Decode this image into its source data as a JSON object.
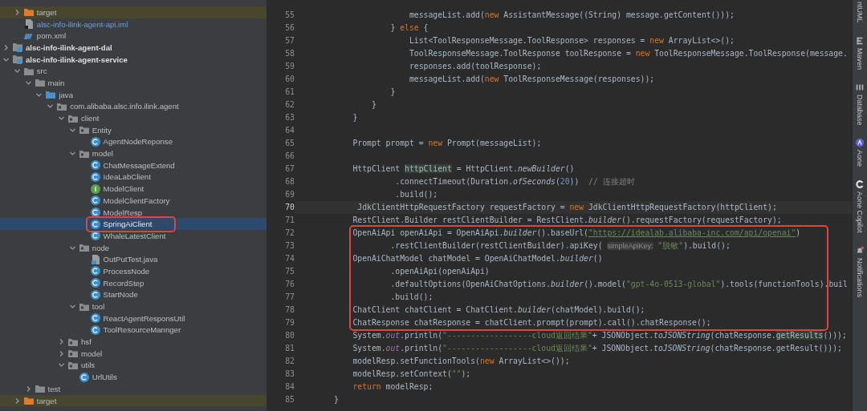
{
  "tree": {
    "continued_children": [
      {
        "label": "target",
        "kind": "excluded-folder",
        "expanded": false,
        "selected": false,
        "annotated": false
      },
      {
        "label": "alsc-info-ilink-agent-api.iml",
        "kind": "iml-file",
        "selected": false,
        "annotated": false
      },
      {
        "label": "pom.xml",
        "kind": "xml-file",
        "selected": false,
        "annotated": false
      }
    ],
    "items": [
      {
        "label": "alsc-info-ilink-agent-dal",
        "kind": "module",
        "expanded": false,
        "selected": false,
        "annotated": false
      },
      {
        "label": "alsc-info-ilink-agent-service",
        "kind": "module",
        "expanded": true,
        "selected": false,
        "annotated": false,
        "children": [
          {
            "label": "src",
            "kind": "folder",
            "expanded": true,
            "selected": false,
            "annotated": false,
            "children": [
              {
                "label": "main",
                "kind": "folder",
                "expanded": true,
                "selected": false,
                "annotated": false,
                "children": [
                  {
                    "label": "java",
                    "kind": "source-folder",
                    "expanded": true,
                    "selected": false,
                    "annotated": false,
                    "children": [
                      {
                        "label": "com.alibaba.alsc.info.ilink.agent",
                        "kind": "package",
                        "expanded": true,
                        "selected": false,
                        "annotated": false,
                        "children": [
                          {
                            "label": "client",
                            "kind": "package",
                            "expanded": true,
                            "selected": false,
                            "annotated": false,
                            "children": [
                              {
                                "label": "Entity",
                                "kind": "package",
                                "expanded": true,
                                "selected": false,
                                "annotated": false,
                                "children": [
                                  {
                                    "label": "AgentNodeReponse",
                                    "kind": "class",
                                    "selected": false,
                                    "annotated": false
                                  }
                                ]
                              },
                              {
                                "label": "model",
                                "kind": "package",
                                "expanded": true,
                                "selected": false,
                                "annotated": false,
                                "children": [
                                  {
                                    "label": "ChatMessageExtend",
                                    "kind": "class",
                                    "selected": false,
                                    "annotated": false
                                  },
                                  {
                                    "label": "IdeaLabClient",
                                    "kind": "class",
                                    "selected": false,
                                    "annotated": false
                                  },
                                  {
                                    "label": "ModelClient",
                                    "kind": "interface",
                                    "selected": false,
                                    "annotated": false
                                  },
                                  {
                                    "label": "ModelClientFactory",
                                    "kind": "class",
                                    "selected": false,
                                    "annotated": false
                                  },
                                  {
                                    "label": "ModelResp",
                                    "kind": "class",
                                    "selected": false,
                                    "annotated": false
                                  },
                                  {
                                    "label": "SpringAiClient",
                                    "kind": "class",
                                    "selected": true,
                                    "annotated": true
                                  },
                                  {
                                    "label": "WhaleLatestClient",
                                    "kind": "class",
                                    "selected": false,
                                    "annotated": false
                                  }
                                ]
                              },
                              {
                                "label": "node",
                                "kind": "package",
                                "expanded": true,
                                "selected": false,
                                "annotated": false,
                                "children": [
                                  {
                                    "label": "OutPutTest.java",
                                    "kind": "java-file",
                                    "selected": false,
                                    "annotated": false
                                  },
                                  {
                                    "label": "ProcessNode",
                                    "kind": "class",
                                    "selected": false,
                                    "annotated": false
                                  },
                                  {
                                    "label": "RecordStep",
                                    "kind": "class",
                                    "selected": false,
                                    "annotated": false
                                  },
                                  {
                                    "label": "StartNode",
                                    "kind": "class",
                                    "selected": false,
                                    "annotated": false
                                  }
                                ]
                              },
                              {
                                "label": "tool",
                                "kind": "package",
                                "expanded": true,
                                "selected": false,
                                "annotated": false,
                                "children": [
                                  {
                                    "label": "ReactAgentResponsUtil",
                                    "kind": "class",
                                    "selected": false,
                                    "annotated": false
                                  },
                                  {
                                    "label": "ToolResourceMannger",
                                    "kind": "class",
                                    "selected": false,
                                    "annotated": false
                                  }
                                ]
                              }
                            ]
                          },
                          {
                            "label": "hsf",
                            "kind": "package",
                            "expanded": false,
                            "selected": false,
                            "annotated": false
                          },
                          {
                            "label": "model",
                            "kind": "package",
                            "expanded": false,
                            "selected": false,
                            "annotated": false
                          },
                          {
                            "label": "utils",
                            "kind": "package",
                            "expanded": true,
                            "selected": false,
                            "annotated": false,
                            "children": [
                              {
                                "label": "UrlUtils",
                                "kind": "class",
                                "selected": false,
                                "annotated": false
                              }
                            ]
                          }
                        ]
                      }
                    ]
                  }
                ]
              },
              {
                "label": "test",
                "kind": "folder",
                "expanded": false,
                "selected": false,
                "annotated": false
              }
            ]
          },
          {
            "label": "target",
            "kind": "excluded-folder",
            "expanded": false,
            "selected": false,
            "annotated": false
          }
        ]
      }
    ]
  },
  "editor": {
    "lines": [
      {
        "number": "55",
        "current": false,
        "boxed": false,
        "segments": [
          {
            "text": "                messageList.add(",
            "kind": "plain"
          },
          {
            "text": "new",
            "kind": "keyword"
          },
          {
            "text": " AssistantMessage((String) message.getContent()));",
            "kind": "plain"
          }
        ]
      },
      {
        "number": "56",
        "current": false,
        "boxed": false,
        "segments": [
          {
            "text": "            } ",
            "kind": "plain"
          },
          {
            "text": "else",
            "kind": "keyword"
          },
          {
            "text": " {",
            "kind": "plain"
          }
        ]
      },
      {
        "number": "57",
        "current": false,
        "boxed": false,
        "segments": [
          {
            "text": "                List<ToolResponseMessage.ToolResponse> responses = ",
            "kind": "plain"
          },
          {
            "text": "new",
            "kind": "keyword"
          },
          {
            "text": " ArrayList<>();",
            "kind": "plain"
          }
        ]
      },
      {
        "number": "58",
        "current": false,
        "boxed": false,
        "segments": [
          {
            "text": "                ToolResponseMessage.ToolResponse toolResponse = ",
            "kind": "plain"
          },
          {
            "text": "new",
            "kind": "keyword"
          },
          {
            "text": " ToolResponseMessage.ToolResponse(message.",
            "kind": "plain"
          }
        ]
      },
      {
        "number": "59",
        "current": false,
        "boxed": false,
        "segments": [
          {
            "text": "                responses.add(toolResponse);",
            "kind": "plain"
          }
        ]
      },
      {
        "number": "60",
        "current": false,
        "boxed": false,
        "segments": [
          {
            "text": "                messageList.add(",
            "kind": "plain"
          },
          {
            "text": "new",
            "kind": "keyword"
          },
          {
            "text": " ToolResponseMessage(responses));",
            "kind": "plain"
          }
        ]
      },
      {
        "number": "61",
        "current": false,
        "boxed": false,
        "segments": [
          {
            "text": "            }",
            "kind": "plain"
          }
        ]
      },
      {
        "number": "62",
        "current": false,
        "boxed": false,
        "segments": [
          {
            "text": "        }",
            "kind": "plain"
          }
        ]
      },
      {
        "number": "63",
        "current": false,
        "boxed": false,
        "segments": [
          {
            "text": "    }",
            "kind": "plain"
          }
        ]
      },
      {
        "number": "64",
        "current": false
      },
      {
        "number": "65",
        "current": false,
        "boxed": false,
        "segments": [
          {
            "text": "    Prompt prompt = ",
            "kind": "plain"
          },
          {
            "text": "new",
            "kind": "keyword"
          },
          {
            "text": " Prompt(messageList);",
            "kind": "plain"
          }
        ]
      },
      {
        "number": "66",
        "current": false
      },
      {
        "number": "67",
        "current": false,
        "boxed": false,
        "segments": [
          {
            "text": "    HttpClient ",
            "kind": "plain"
          },
          {
            "text": "httpClient",
            "kind": "usage"
          },
          {
            "text": " = HttpClient.",
            "kind": "plain"
          },
          {
            "text": "newBuilder",
            "kind": "italic"
          },
          {
            "text": "()",
            "kind": "plain"
          }
        ]
      },
      {
        "number": "68",
        "current": false,
        "boxed": false,
        "segments": [
          {
            "text": "             .connectTimeout(Duration.",
            "kind": "plain"
          },
          {
            "text": "ofSeconds",
            "kind": "italic"
          },
          {
            "text": "(",
            "kind": "plain"
          },
          {
            "text": "20",
            "kind": "number"
          },
          {
            "text": "))  ",
            "kind": "plain"
          },
          {
            "text": "// 连接超时",
            "kind": "comment"
          }
        ]
      },
      {
        "number": "69",
        "current": false,
        "boxed": false,
        "segments": [
          {
            "text": "             .build();",
            "kind": "plain"
          }
        ]
      },
      {
        "number": "70",
        "current": true,
        "boxed": false,
        "segments": [
          {
            "text": "     JdkClientHttpRequestFactory requestFactory = ",
            "kind": "plain"
          },
          {
            "text": "new",
            "kind": "keyword"
          },
          {
            "text": " JdkClientHttpRequestFactory(httpClient);",
            "kind": "plain"
          }
        ]
      },
      {
        "number": "71",
        "current": false,
        "boxed": false,
        "segments": [
          {
            "text": "    RestClient.Builder restClientBuilder = RestClient.",
            "kind": "plain"
          },
          {
            "text": "builder",
            "kind": "italic"
          },
          {
            "text": "().requestFactory(requestFactory);",
            "kind": "plain"
          }
        ]
      },
      {
        "number": "72",
        "current": false,
        "boxed": true,
        "segments": [
          {
            "text": "    OpenAiApi openAiApi = OpenAiApi.",
            "kind": "plain"
          },
          {
            "text": "builder",
            "kind": "italic"
          },
          {
            "text": "().baseUrl(",
            "kind": "plain"
          },
          {
            "text": "\"https://idealab.alibaba-inc.com/api/openai\"",
            "kind": "url"
          },
          {
            "text": ")",
            "kind": "plain"
          }
        ]
      },
      {
        "number": "73",
        "current": false,
        "boxed": true,
        "segments": [
          {
            "text": "            .restClientBuilder(restClientBuilder).apiKey( ",
            "kind": "plain"
          },
          {
            "text": "simpleApiKey:",
            "kind": "hint"
          },
          {
            "text": " \"脱敏\"",
            "kind": "string"
          },
          {
            "text": ").build();",
            "kind": "plain"
          }
        ]
      },
      {
        "number": "74",
        "current": false,
        "boxed": true,
        "segments": [
          {
            "text": "    OpenAiChatModel chatModel = OpenAiChatModel.",
            "kind": "plain"
          },
          {
            "text": "builder",
            "kind": "italic"
          },
          {
            "text": "()",
            "kind": "plain"
          }
        ]
      },
      {
        "number": "75",
        "current": false,
        "boxed": true,
        "segments": [
          {
            "text": "            .openAiApi(openAiApi)",
            "kind": "plain"
          }
        ]
      },
      {
        "number": "76",
        "current": false,
        "boxed": true,
        "segments": [
          {
            "text": "            .defaultOptions(OpenAiChatOptions.",
            "kind": "plain"
          },
          {
            "text": "builder",
            "kind": "italic"
          },
          {
            "text": "().model(",
            "kind": "plain"
          },
          {
            "text": "\"gpt-4o-0513-global\"",
            "kind": "string"
          },
          {
            "text": ").tools(functionTools).buil",
            "kind": "plain"
          }
        ]
      },
      {
        "number": "77",
        "current": false,
        "boxed": true,
        "segments": [
          {
            "text": "            .build();",
            "kind": "plain"
          }
        ]
      },
      {
        "number": "78",
        "current": false,
        "boxed": true,
        "segments": [
          {
            "text": "    ChatClient chatClient = ChatClient.",
            "kind": "plain"
          },
          {
            "text": "builder",
            "kind": "italic"
          },
          {
            "text": "(chatModel).build();",
            "kind": "plain"
          }
        ]
      },
      {
        "number": "79",
        "current": false,
        "boxed": true,
        "segments": [
          {
            "text": "    ChatResponse chatResponse = chatClient.prompt(prompt).call().chatResponse();",
            "kind": "plain"
          }
        ]
      },
      {
        "number": "80",
        "current": false,
        "boxed": false,
        "segments": [
          {
            "text": "    System.",
            "kind": "plain"
          },
          {
            "text": "out",
            "kind": "field"
          },
          {
            "text": ".println(",
            "kind": "plain"
          },
          {
            "text": "\"------------------cloud返回结果\"",
            "kind": "string"
          },
          {
            "text": "+ JSONObject.",
            "kind": "plain"
          },
          {
            "text": "toJSONString",
            "kind": "italic"
          },
          {
            "text": "(chatResponse.",
            "kind": "plain"
          },
          {
            "text": "getResults",
            "kind": "usage"
          },
          {
            "text": "()));",
            "kind": "plain"
          }
        ]
      },
      {
        "number": "81",
        "current": false,
        "boxed": false,
        "segments": [
          {
            "text": "    System.",
            "kind": "plain"
          },
          {
            "text": "out",
            "kind": "field"
          },
          {
            "text": ".println(",
            "kind": "plain"
          },
          {
            "text": "\"------------------cloud返回结果\"",
            "kind": "string"
          },
          {
            "text": "+ JSONObject.",
            "kind": "plain"
          },
          {
            "text": "toJSONString",
            "kind": "italic"
          },
          {
            "text": "(chatResponse.getResult()));",
            "kind": "plain"
          }
        ]
      },
      {
        "number": "82",
        "current": false,
        "boxed": false,
        "segments": [
          {
            "text": "    modelResp.setFunctionTools(",
            "kind": "plain"
          },
          {
            "text": "new",
            "kind": "keyword"
          },
          {
            "text": " ArrayList<>());",
            "kind": "plain"
          }
        ]
      },
      {
        "number": "83",
        "current": false,
        "boxed": false,
        "segments": [
          {
            "text": "    modelResp.setContext(",
            "kind": "plain"
          },
          {
            "text": "\"\"",
            "kind": "string"
          },
          {
            "text": ");",
            "kind": "plain"
          }
        ]
      },
      {
        "number": "84",
        "current": false,
        "boxed": false,
        "segments": [
          {
            "text": "    return",
            "kind": "keyword"
          },
          {
            "text": " modelResp;",
            "kind": "plain"
          }
        ]
      },
      {
        "number": "85",
        "current": false,
        "boxed": false,
        "segments": [
          {
            "text": "}",
            "kind": "plain"
          }
        ]
      }
    ]
  },
  "tool_strip": {
    "items": [
      {
        "label": "ntUML",
        "kind": "plain"
      },
      {
        "label": "Maven",
        "kind": "maven"
      },
      {
        "label": "Database",
        "kind": "database"
      },
      {
        "label": "Aone",
        "kind": "aone"
      },
      {
        "label": "Aone Copilot",
        "kind": "copilot"
      },
      {
        "label": "Notifications",
        "kind": "bell"
      }
    ]
  }
}
